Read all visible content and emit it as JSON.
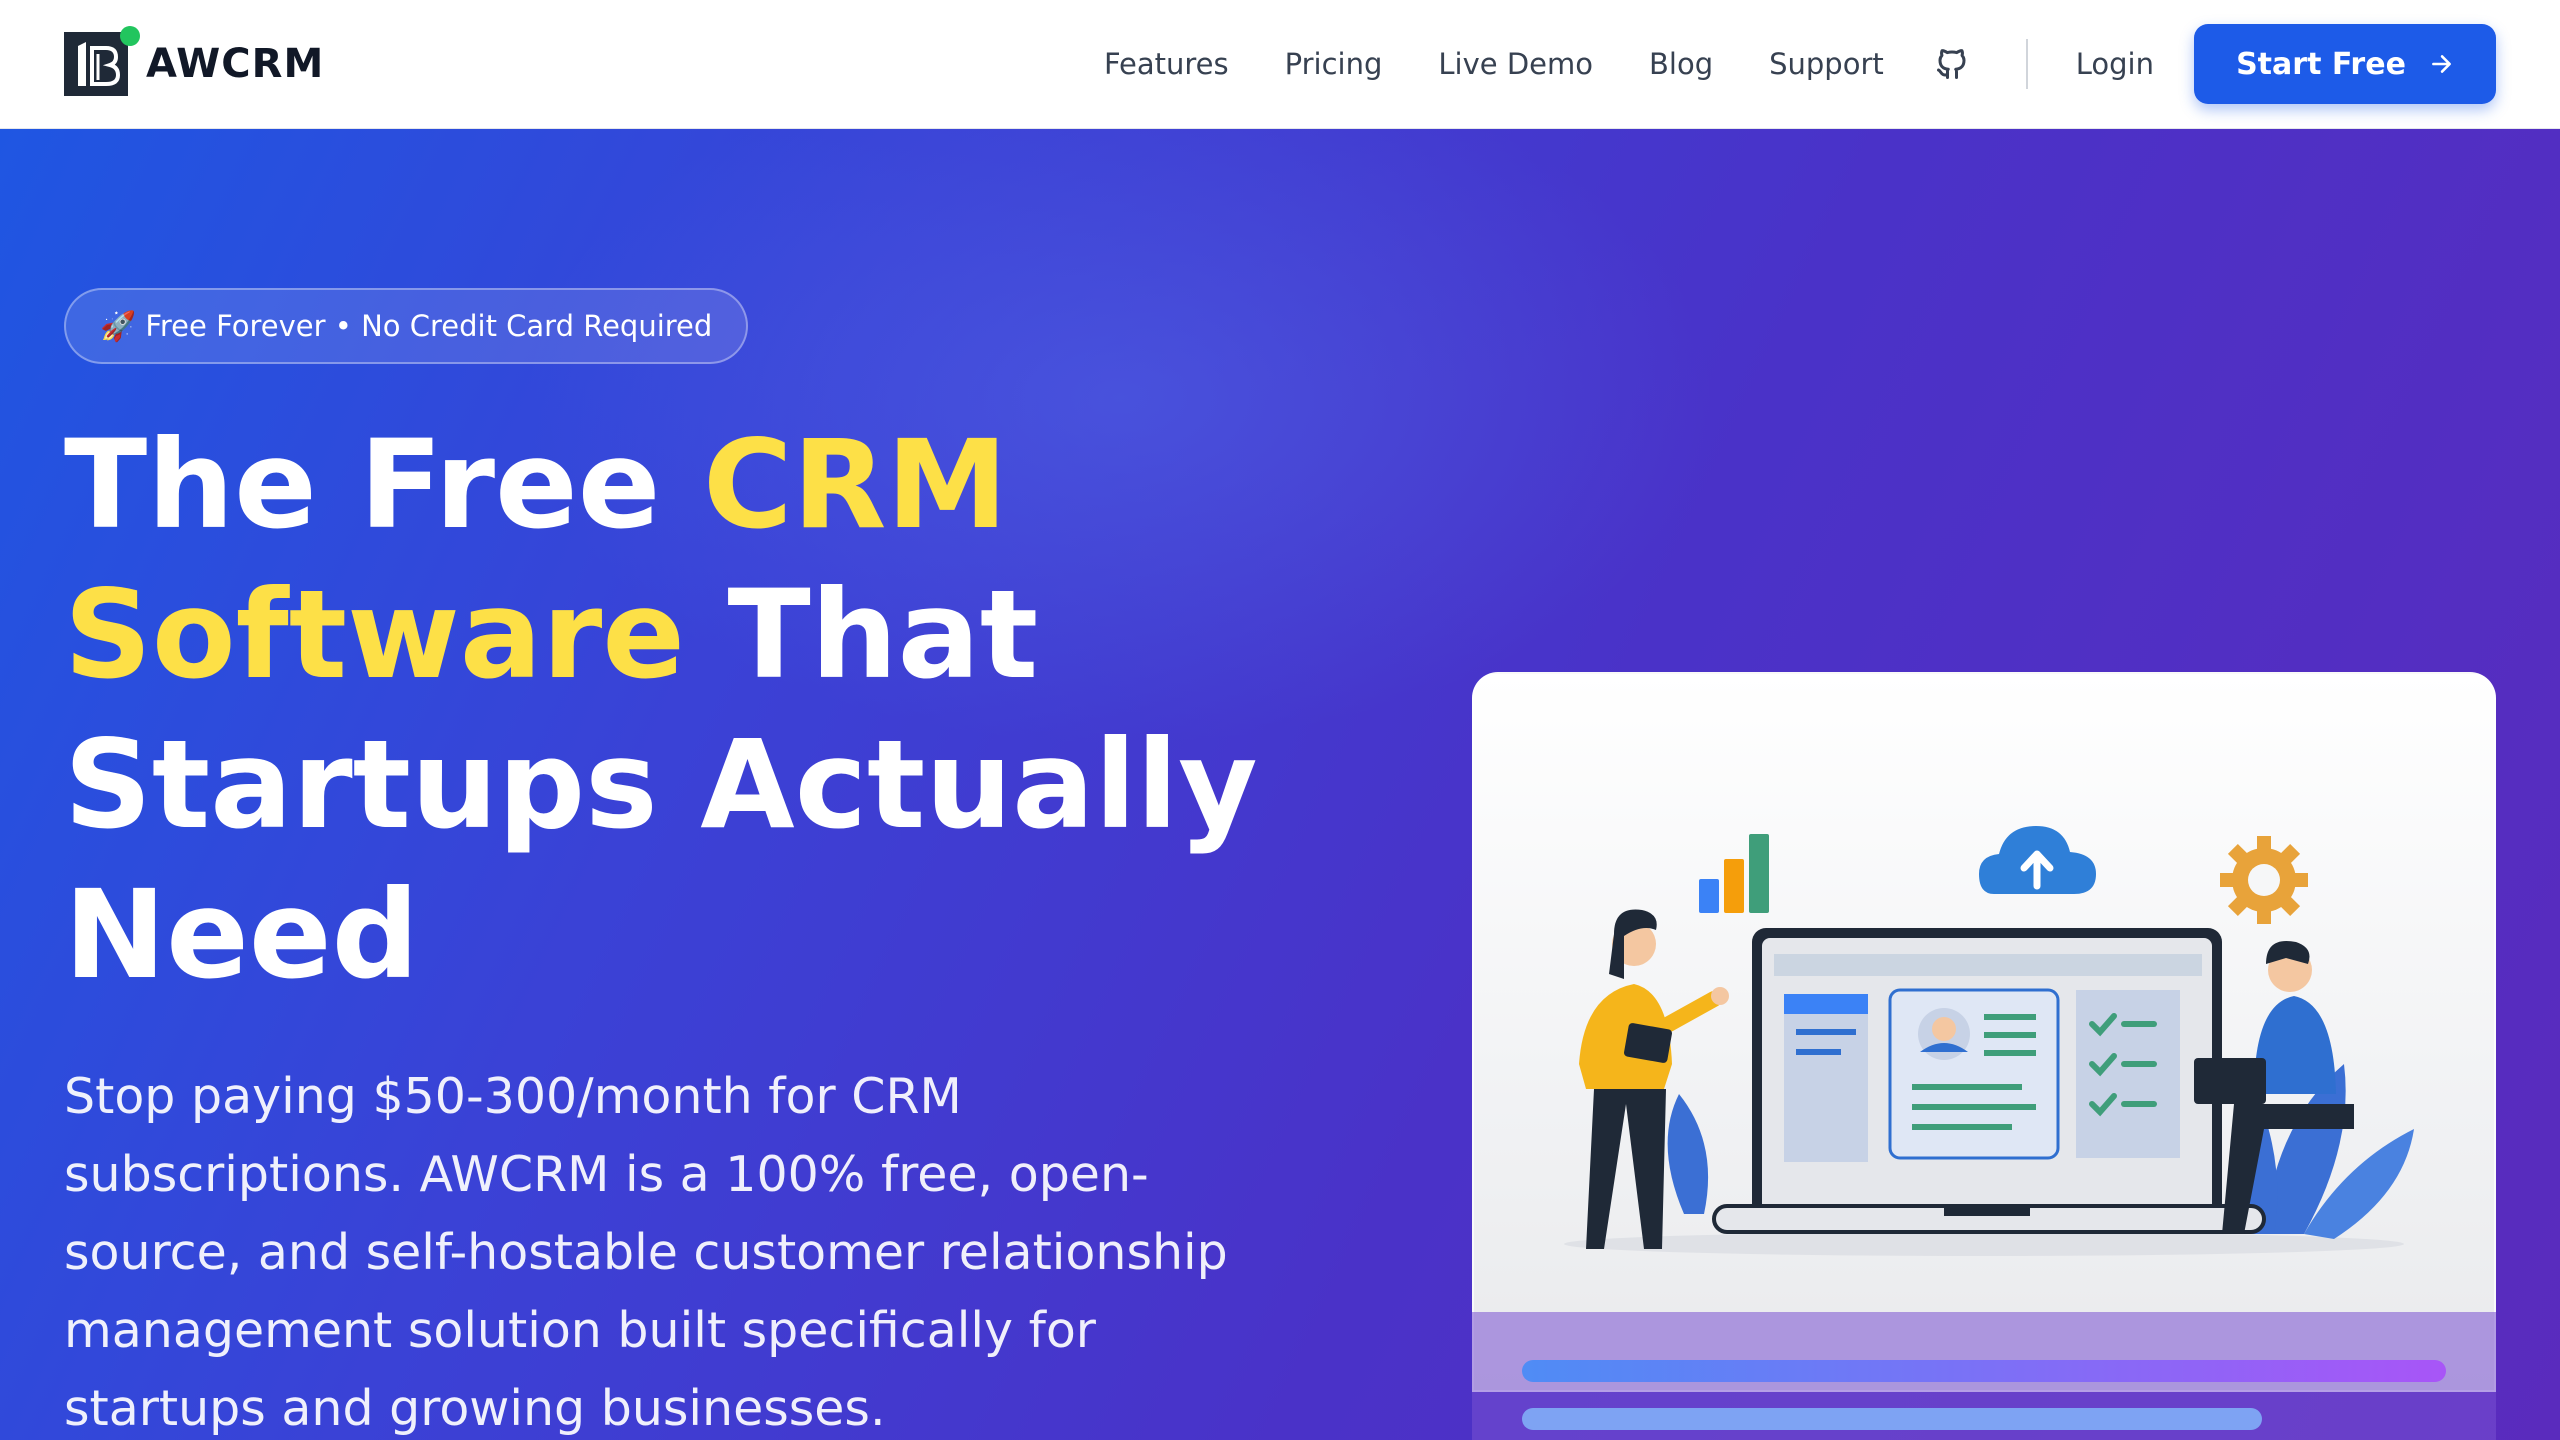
{
  "nav": {
    "brand": "AWCRM",
    "links": [
      "Features",
      "Pricing",
      "Live Demo",
      "Blog",
      "Support"
    ],
    "login": "Login",
    "cta": "Start Free"
  },
  "hero": {
    "badge": "🚀 Free Forever • No Credit Card Required",
    "headline": {
      "part1": "The Free ",
      "highlight": "CRM Software",
      "part2": " That Startups Actually Need"
    },
    "subtitle": "Stop paying $50-300/month for CRM subscriptions. AWCRM is a 100% free, open-source, and self-hostable customer relationship management solution built specifically for startups and growing businesses."
  },
  "colors": {
    "accent_blue": "#1d5be8",
    "highlight_yellow": "#fde047",
    "status_green": "#22c55e"
  }
}
